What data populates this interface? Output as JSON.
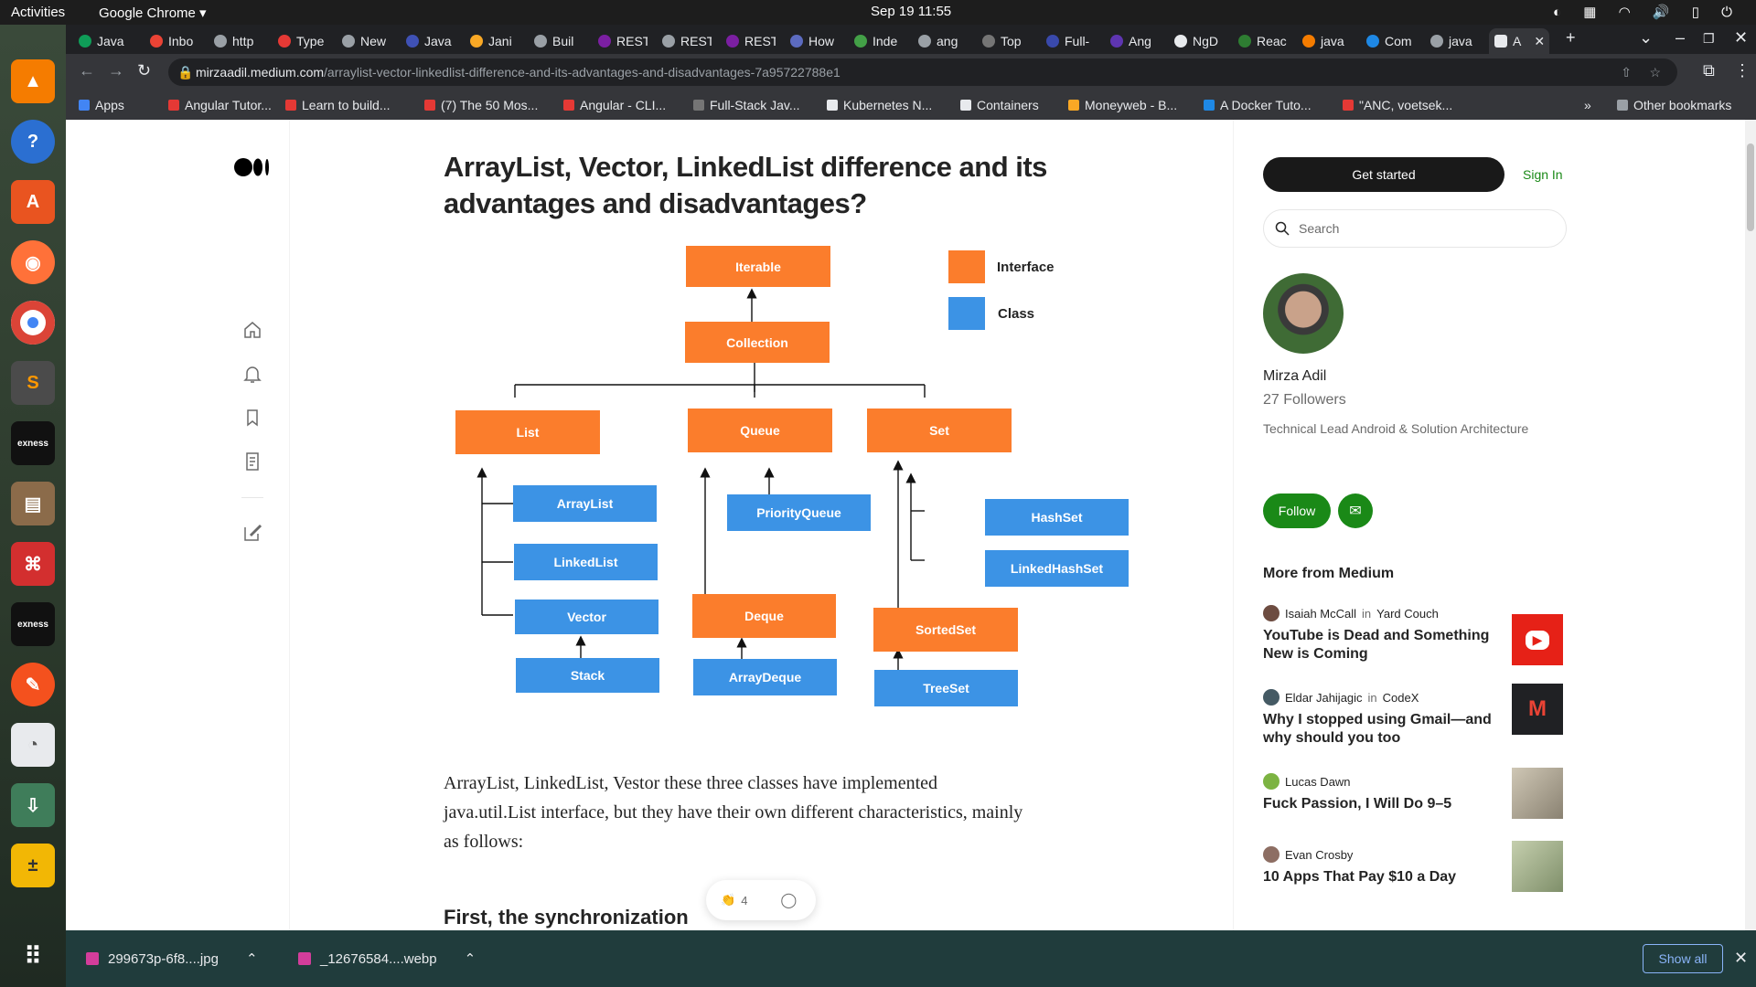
{
  "system": {
    "activities": "Activities",
    "app_name": "Google Chrome",
    "clock": "Sep 19  11:55"
  },
  "tabs": [
    {
      "label": "Java",
      "color": "#0f9d58"
    },
    {
      "label": "Inbo",
      "color": "#ea4335"
    },
    {
      "label": "http",
      "color": "#9aa0a6"
    },
    {
      "label": "Type",
      "color": "#e53935"
    },
    {
      "label": "New",
      "color": "#9aa0a6"
    },
    {
      "label": "Java",
      "color": "#3f51b5"
    },
    {
      "label": "Jani",
      "color": "#f9a825"
    },
    {
      "label": "Buil",
      "color": "#9aa0a6"
    },
    {
      "label": "REST",
      "color": "#7b1fa2"
    },
    {
      "label": "REST",
      "color": "#9aa0a6"
    },
    {
      "label": "REST",
      "color": "#7b1fa2"
    },
    {
      "label": "How",
      "color": "#5c6bc0"
    },
    {
      "label": "Inde",
      "color": "#43a047"
    },
    {
      "label": "ang",
      "color": "#9aa0a6"
    },
    {
      "label": "Top",
      "color": "#757575"
    },
    {
      "label": "Full-",
      "color": "#3949ab"
    },
    {
      "label": "Ang",
      "color": "#5e35b1"
    },
    {
      "label": "NgD",
      "color": "#e8eaed"
    },
    {
      "label": "Reac",
      "color": "#2e7d32"
    },
    {
      "label": "java",
      "color": "#f57c00"
    },
    {
      "label": "Com",
      "color": "#1e88e5"
    },
    {
      "label": "java",
      "color": "#9aa0a6"
    },
    {
      "label": "A",
      "color": "#e8eaed"
    }
  ],
  "address": {
    "domain": "mirzaadil.medium.com",
    "path": "/arraylist-vector-linkedlist-difference-and-its-advantages-and-disadvantages-7a95722788e1"
  },
  "bookmarks": [
    {
      "label": "Apps",
      "color": "#4285f4"
    },
    {
      "label": "Angular Tutor...",
      "color": "#e53935"
    },
    {
      "label": "Learn to build...",
      "color": "#e53935"
    },
    {
      "label": "(7) The 50 Mos...",
      "color": "#e53935"
    },
    {
      "label": "Angular - CLI...",
      "color": "#e53935"
    },
    {
      "label": "Full-Stack Jav...",
      "color": "#757575"
    },
    {
      "label": "Kubernetes N...",
      "color": "#e8eaed"
    },
    {
      "label": "Containers",
      "color": "#e8eaed"
    },
    {
      "label": "Moneyweb - B...",
      "color": "#f9a825"
    },
    {
      "label": "A Docker Tuto...",
      "color": "#1e88e5"
    },
    {
      "label": "\"ANC, voetsek...",
      "color": "#e53935"
    }
  ],
  "other_bookmarks": "Other bookmarks",
  "article": {
    "title": "ArrayList, Vector, LinkedList difference and its advantages and disadvantages?",
    "body": "ArrayList, LinkedList, Vestor these three classes have implemented java.util.List interface, but they have their own different characteristics, mainly as follows:",
    "heading": "First, the synchronization",
    "claps": "4"
  },
  "diagram": {
    "interfaces": {
      "iterable": "Iterable",
      "collection": "Collection",
      "list": "List",
      "queue": "Queue",
      "set": "Set",
      "deque": "Deque",
      "sortedset": "SortedSet"
    },
    "classes": {
      "arraylist": "ArrayList",
      "linkedlist": "LinkedList",
      "vector": "Vector",
      "stack": "Stack",
      "priorityqueue": "PriorityQueue",
      "arraydeque": "ArrayDeque",
      "hashset": "HashSet",
      "linkedhashset": "LinkedHashSet",
      "treeset": "TreeSet"
    },
    "legend": {
      "interface": "Interface",
      "class": "Class"
    },
    "colors": {
      "interface": "#fb7d2c",
      "class": "#3c93e5"
    }
  },
  "sidebar": {
    "get_started": "Get started",
    "sign_in": "Sign In",
    "search_placeholder": "Search",
    "author": "Mirza Adil",
    "followers": "27 Followers",
    "bio": "Technical Lead Android & Solution Architecture",
    "follow": "Follow",
    "more_from": "More from Medium",
    "stories": [
      {
        "author": "Isaiah McCall",
        "in": "in",
        "pub": "Yard Couch",
        "title": "YouTube is Dead and Something New is Coming",
        "thumb": "#e62117"
      },
      {
        "author": "Eldar Jahijagic",
        "in": "in",
        "pub": "CodeX",
        "title": "Why I stopped using Gmail—and why should you too",
        "thumb": "#202124"
      },
      {
        "author": "Lucas Dawn",
        "in": "",
        "pub": "",
        "title": "Fuck Passion, I Will Do 9–5",
        "thumb": "#b9b1a0"
      },
      {
        "author": "Evan Crosby",
        "in": "",
        "pub": "",
        "title": "10 Apps That Pay $10 a Day",
        "thumb": "#9bab8a"
      }
    ]
  },
  "downloads": {
    "items": [
      "299673p-6f8....jpg",
      "_12676584....webp"
    ],
    "show_all": "Show all"
  }
}
